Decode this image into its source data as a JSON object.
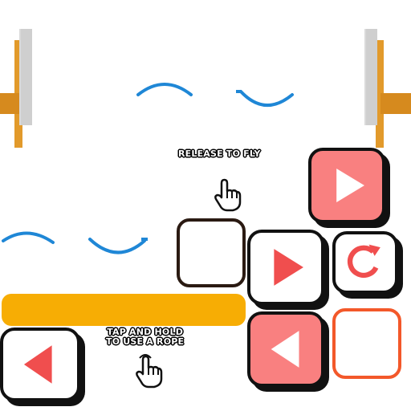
{
  "hints": {
    "release": "RELEASE TO FLY",
    "tap_line1": "TAP AND HOLD",
    "tap_line2": "TO USE A ROPE"
  },
  "colors": {
    "pink": "#f98080",
    "red": "#f04e4e",
    "white": "#ffffff",
    "orange_bar": "#f7ad04",
    "orange_outline": "#f3582a",
    "rope_blue": "#1f87d6",
    "post_wood": "#d68a1e",
    "post_grey": "#cfcfcf"
  },
  "icons": {
    "hand": "pointing-hand-icon",
    "play": "play-triangle-icon",
    "back": "back-triangle-icon",
    "restart": "restart-arrow-icon"
  }
}
